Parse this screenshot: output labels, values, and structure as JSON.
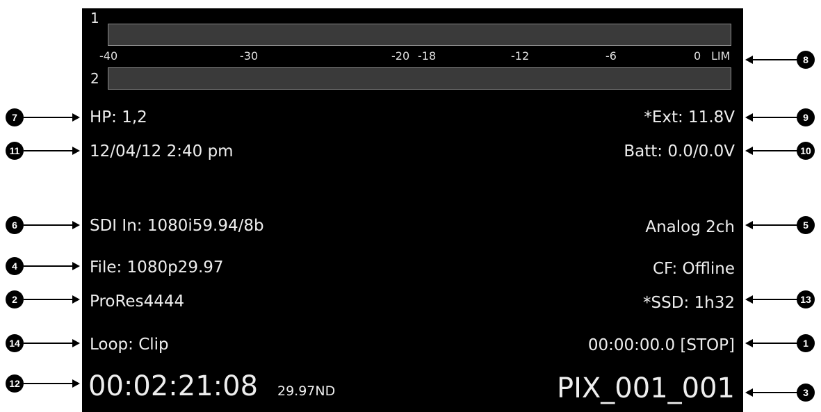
{
  "meters": {
    "channels": [
      {
        "label": "1",
        "level": 0
      },
      {
        "label": "2",
        "level": 0
      }
    ],
    "scale": [
      "-40",
      "-30",
      "-20",
      "-18",
      "-12",
      "-6",
      "0",
      "LIM"
    ],
    "colors": {
      "track": "#3a3a3a",
      "border": "#8a8a8a"
    }
  },
  "status": {
    "headphones": "HP: 1,2",
    "datetime": "12/04/12 2:40 pm",
    "external_power": "*Ext: 11.8V",
    "battery": "Batt: 0.0/0.0V",
    "sdi_input": "SDI In: 1080i59.94/8b",
    "audio_input": "Analog 2ch",
    "file_format": "File: 1080p29.97",
    "cf_card": "CF: Offline",
    "codec": "ProRes4444",
    "ssd": "*SSD: 1h32",
    "loop_mode": "Loop: Clip",
    "transport": "00:00:00.0 [STOP]",
    "timecode": "00:02:21:08",
    "timecode_rate": "29.97ND",
    "clip_name": "PIX_001_001"
  },
  "callouts": [
    "1",
    "2",
    "3",
    "4",
    "5",
    "6",
    "7",
    "8",
    "9",
    "10",
    "11",
    "12",
    "13",
    "14"
  ]
}
